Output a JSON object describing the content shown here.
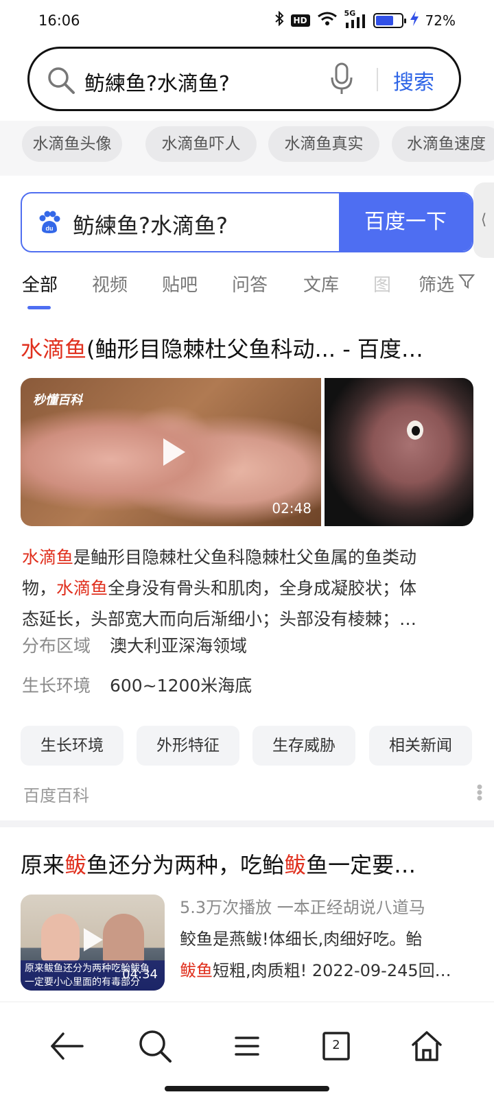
{
  "status_bar": {
    "time": "16:06",
    "hd": "HD",
    "network": "5G",
    "battery_pct": "72%",
    "battery_level": 0.72
  },
  "top_search": {
    "query": "鲂練鱼?水滴鱼?",
    "submit": "搜索"
  },
  "suggestions": [
    "水滴鱼头像",
    "水滴鱼吓人",
    "水滴鱼真实",
    "水滴鱼速度"
  ],
  "baidu_box": {
    "query": "鲂練鱼?水滴鱼?",
    "submit": "百度一下"
  },
  "tabs": [
    "全部",
    "视频",
    "贴吧",
    "问答",
    "文库",
    "图"
  ],
  "filter_label": "筛选",
  "result1": {
    "title_hl": "水滴鱼",
    "title_rest": "(鲉形目隐棘杜父鱼科动... - 百度…",
    "video_brand": "秒懂百科",
    "video_duration": "02:48",
    "desc_line1_hl": "水滴鱼",
    "desc_line1_rest": "是鲉形目隐棘杜父鱼科隐棘杜父鱼属的鱼类动",
    "desc_line2_pre": "物，",
    "desc_line2_hl": "水滴鱼",
    "desc_line2_rest": "全身没有骨头和肌肉，全身成凝胶状；体",
    "desc_line3": "态延长，头部宽大而向后渐细小；头部没有棱棘；…",
    "facts": [
      {
        "key": "分布区域",
        "value": "澳大利亚深海领域"
      },
      {
        "key": "生长环境",
        "value": "600~1200米海底"
      }
    ],
    "quick_links": [
      "生长环境",
      "外形特征",
      "生存威胁",
      "相关新闻"
    ],
    "source": "百度百科"
  },
  "result2": {
    "title_pre": "原来",
    "title_hl1": "鲅",
    "title_mid": "鱼还分为两种，吃鲐",
    "title_hl2": "鲅",
    "title_rest": "鱼一定要…",
    "thumb_caption1": "原来鲅鱼还分为两种吃鲐鲅鱼",
    "thumb_caption2": "一定要小心里面的有毒部分",
    "thumb_duration": "04:34",
    "meta": "5.3万次播放 一本正经胡说八道马",
    "line2": "鲛鱼是燕鲅!体细长,肉细好吃。鲐",
    "line3_hl": "鲅鱼",
    "line3_rest": "短粗,肉质粗! 2022-09-245回…"
  },
  "bottom_nav": {
    "tab_count": "2"
  }
}
